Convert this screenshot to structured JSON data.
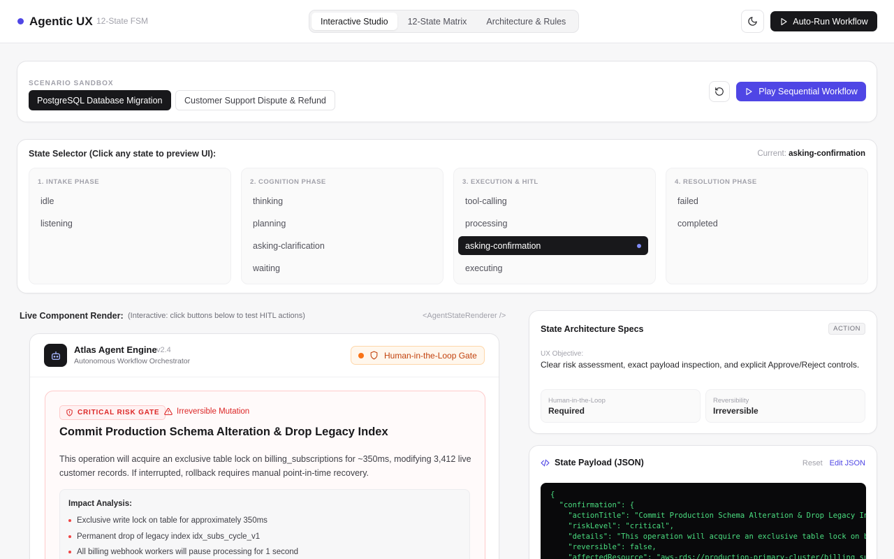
{
  "header": {
    "brand": "Agentic UX",
    "subtitle": "12-State FSM",
    "tabs": [
      {
        "label": "Interactive Studio"
      },
      {
        "label": "12-State Matrix"
      },
      {
        "label": "Architecture & Rules"
      }
    ],
    "autorun_label": "Auto-Run Workflow"
  },
  "sandbox": {
    "eyebrow": "SCENARIO SANDBOX",
    "scenarios": [
      "PostgreSQL Database Migration",
      "Customer Support Dispute & Refund"
    ],
    "play_label": "Play Sequential Workflow"
  },
  "selector": {
    "title": "State Selector (Click any state to preview UI):",
    "current_label": "Current:",
    "current_value": "asking-confirmation",
    "phases": [
      {
        "name": "1. INTAKE PHASE",
        "states": [
          "idle",
          "listening"
        ]
      },
      {
        "name": "2. COGNITION PHASE",
        "states": [
          "thinking",
          "planning",
          "asking-clarification",
          "waiting"
        ]
      },
      {
        "name": "3. EXECUTION & HITL",
        "states": [
          "tool-calling",
          "processing",
          "asking-confirmation",
          "executing"
        ]
      },
      {
        "name": "4. RESOLUTION PHASE",
        "states": [
          "failed",
          "completed"
        ]
      }
    ]
  },
  "live": {
    "label": "Live Component Render:",
    "hint": "(Interactive: click buttons below to test HITL actions)",
    "tag": "<AgentStateRenderer />"
  },
  "agent": {
    "name": "Atlas Agent Engine",
    "version": "v2.4",
    "role": "Autonomous Workflow Orchestrator",
    "badge": "Human-in-the-Loop Gate"
  },
  "risk": {
    "badge": "CRITICAL RISK GATE",
    "irreversible": "Irreversible Mutation",
    "title": "Commit Production Schema Alteration & Drop Legacy Index",
    "description": "This operation will acquire an exclusive table lock on billing_subscriptions for ~350ms, modifying 3,412 live customer records. If interrupted, rollback requires manual point-in-time recovery.",
    "impact_title": "Impact Analysis:",
    "impact": [
      "Exclusive write lock on table for approximately 350ms",
      "Permanent drop of legacy index idx_subs_cycle_v1",
      "All billing webhook workers will pause processing for 1 second"
    ]
  },
  "specs": {
    "title": "State Architecture Specs",
    "badge": "ACTION",
    "objective_label": "UX Objective:",
    "objective": "Clear risk assessment, exact payload inspection, and explicit Approve/Reject controls.",
    "hitl_label": "Human-in-the-Loop",
    "hitl_value": "Required",
    "rev_label": "Reversibility",
    "rev_value": "Irreversible"
  },
  "payload": {
    "title": "State Payload (JSON)",
    "reset": "Reset",
    "edit": "Edit JSON",
    "code": "{\n  \"confirmation\": {\n    \"actionTitle\": \"Commit Production Schema Alteration & Drop Legacy Index\",\n    \"riskLevel\": \"critical\",\n    \"details\": \"This operation will acquire an exclusive table lock on billing_subscriptions for ~350ms\",\n    \"reversible\": false,\n    \"affectedResource\": \"aws-rds://production-primary-cluster/billing_subscriptions\""
  },
  "colors": {
    "accent": "#4f46e5",
    "critical": "#dc2626",
    "warning": "#c2410c",
    "dark": "#18181b"
  }
}
